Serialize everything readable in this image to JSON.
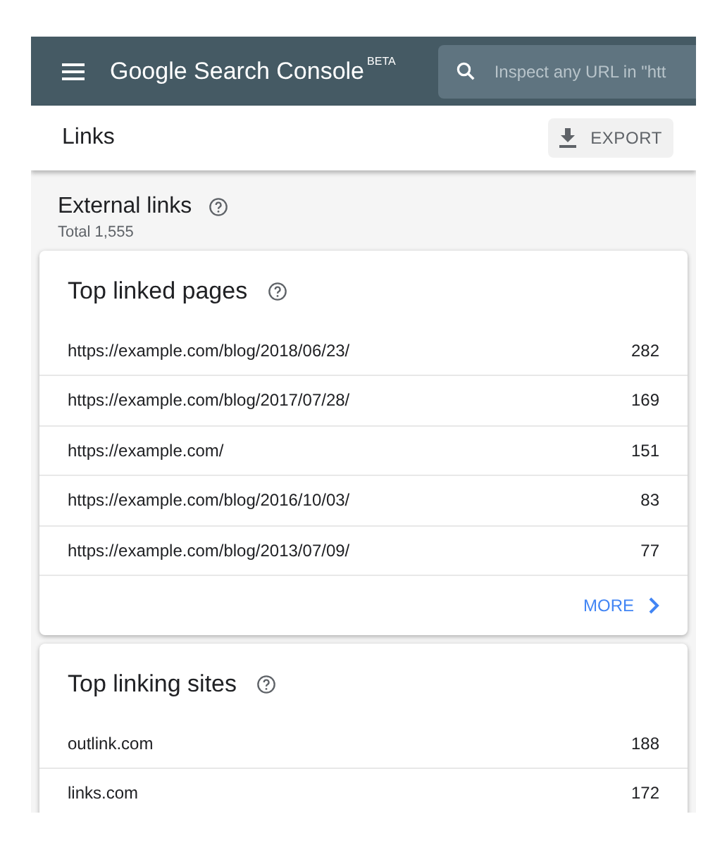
{
  "header": {
    "brand": "Google Search Console",
    "badge": "BETA",
    "search": {
      "placeholder": "Inspect any URL in \"htt"
    }
  },
  "page": {
    "title": "Links",
    "export_button": "EXPORT"
  },
  "section": {
    "title": "External links",
    "total": "Total 1,555"
  },
  "cards": [
    {
      "title": "Top linked pages",
      "rows": [
        {
          "label": "https://example.com/blog/2018/06/23/",
          "value": "282"
        },
        {
          "label": "https://example.com/blog/2017/07/28/",
          "value": "169"
        },
        {
          "label": "https://example.com/",
          "value": "151"
        },
        {
          "label": "https://example.com/blog/2016/10/03/",
          "value": "83"
        },
        {
          "label": "https://example.com/blog/2013/07/09/",
          "value": "77"
        }
      ],
      "more": "MORE"
    },
    {
      "title": "Top linking sites",
      "rows": [
        {
          "label": "outlink.com",
          "value": "188"
        },
        {
          "label": "links.com",
          "value": "172"
        }
      ]
    }
  ]
}
